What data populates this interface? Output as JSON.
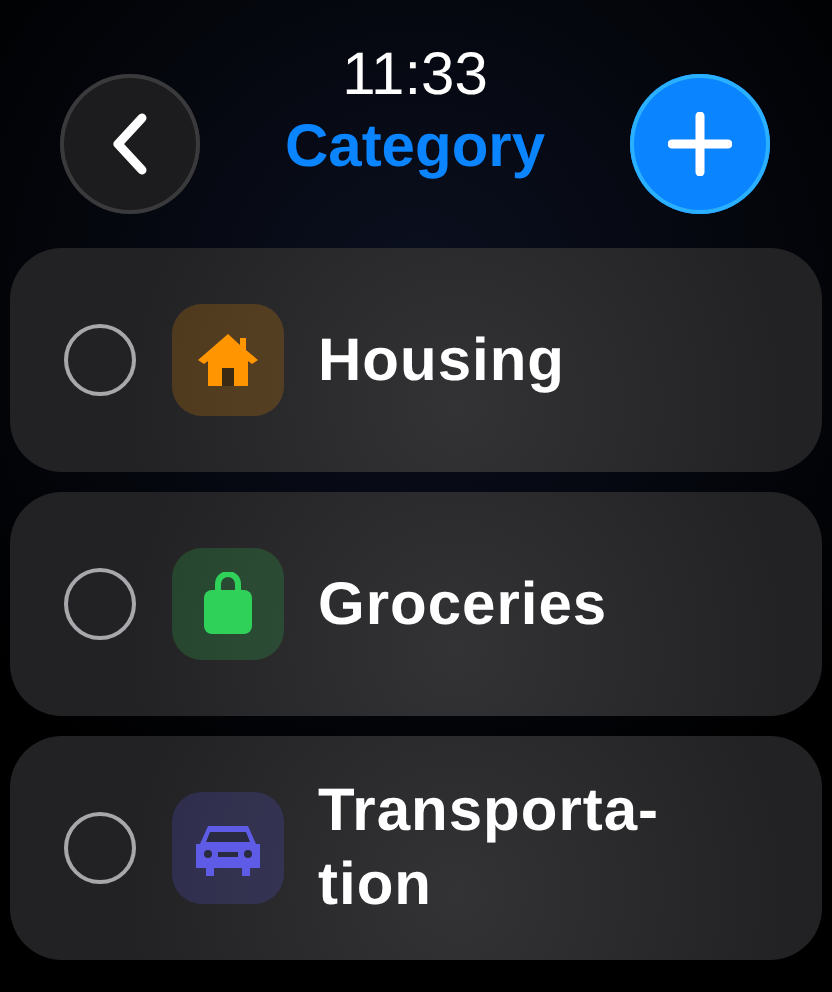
{
  "header": {
    "time": "11:33",
    "title": "Category"
  },
  "categories": [
    {
      "name": "Housing",
      "kind": "house",
      "color": "#ff9500",
      "selected": false
    },
    {
      "name": "Groceries",
      "kind": "bag",
      "color": "#30d158",
      "selected": false
    },
    {
      "name": "Transporta-tion",
      "kind": "car",
      "color": "#5e5ce6",
      "selected": false
    }
  ]
}
